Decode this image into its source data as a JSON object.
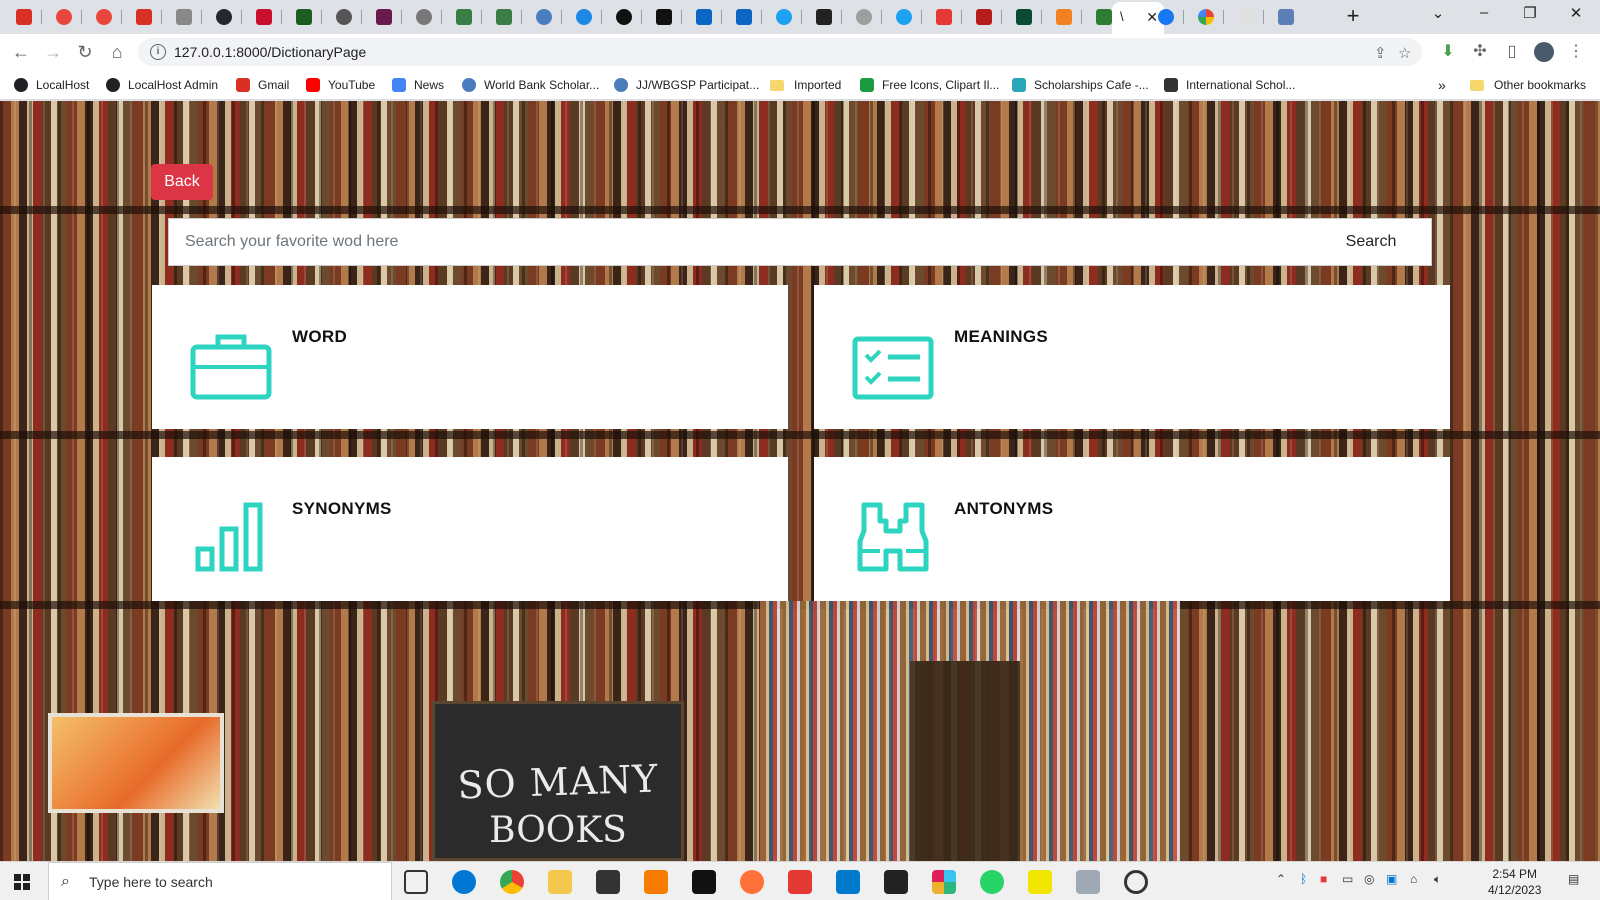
{
  "browser": {
    "active_tab_title": "\\",
    "address_url": "127.0.0.1:8000/DictionaryPage",
    "bookmarks": [
      {
        "label": "LocalHost",
        "color": "#202124"
      },
      {
        "label": "LocalHost Admin",
        "color": "#202124"
      },
      {
        "label": "Gmail",
        "color": "#d93025"
      },
      {
        "label": "YouTube",
        "color": "#ff0000"
      },
      {
        "label": "News",
        "color": "#4285f4"
      },
      {
        "label": "World Bank Scholar...",
        "color": "#4a7dbd"
      },
      {
        "label": "JJ/WBGSP Participat...",
        "color": "#4a7dbd"
      },
      {
        "label": "Imported",
        "color": "#f5d76e"
      },
      {
        "label": "Free Icons, Clipart Il...",
        "color": "#1a9b3f"
      },
      {
        "label": "Scholarships Cafe -...",
        "color": "#2aa6b8"
      },
      {
        "label": "International Schol...",
        "color": "#333333"
      }
    ],
    "overflow_label": "»",
    "other_bookmarks_label": "Other bookmarks"
  },
  "page": {
    "back_label": "Back",
    "search": {
      "placeholder": "Search your favorite wod here",
      "button_label": "Search"
    },
    "cards": [
      {
        "title": "WORD",
        "icon": "briefcase-icon"
      },
      {
        "title": "MEANINGS",
        "icon": "checklist-icon"
      },
      {
        "title": "SYNONYMS",
        "icon": "bar-chart-icon"
      },
      {
        "title": "ANTONYMS",
        "icon": "binoculars-icon"
      }
    ],
    "background_sign": {
      "line1": "SO MANY",
      "line2": "BOOKS"
    },
    "accent_color": "#2dd4bf",
    "back_color": "#dc3545"
  },
  "taskbar": {
    "search_placeholder": "Type here to search",
    "time": "2:54 PM",
    "date": "4/12/2023"
  }
}
